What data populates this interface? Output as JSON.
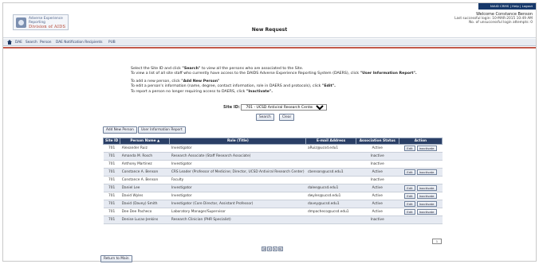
{
  "header": {
    "logo_line1": "Adverse Experience Reporting",
    "logo_line2": "Division of AIDS",
    "page_title": "New Request",
    "toplinks": "NIAID CRMS | Help | Logout",
    "welcome_name": "Welcome Constance Benson",
    "welcome_line1": "Last successful login: 10-MAR-2015 10:49 AM",
    "welcome_line2": "No. of unsuccessful login attempts: 0"
  },
  "nav": {
    "items": [
      "DAE",
      "Search",
      "Person",
      "DAE Notification Recipients",
      "PUB"
    ]
  },
  "instructions": {
    "line1a": "Select the Site ID and click ",
    "line1b": "\"Search\"",
    "line1c": " to view all the persons who are associated to the Site.",
    "line2a": "To view a list of all site staff who currently have access to the DAIDS Adverse Experience Reporting System (DAERS), click ",
    "line2b": "\"User Information Report\".",
    "line3a": "To add a new person, click ",
    "line3b": "\"Add New Person\"",
    "line4a": "To edit a person's information (name, degree, contact information, role in DAERS and protocols), click ",
    "line4b": "\"Edit\".",
    "line5a": "To report a person no longer requiring access to DAERS, click ",
    "line5b": "\"Inactivate\"."
  },
  "site": {
    "label": "Site ID:",
    "selected": "701 - UCSD Antiviral Research Center CRS"
  },
  "buttons": {
    "search": "Search",
    "clear": "Clear",
    "add_person": "Add New Person",
    "user_report": "User Information Report",
    "return": "Return to Main",
    "edit": "Edit",
    "inactivate": "Inactivate"
  },
  "table": {
    "headers": [
      "Site ID",
      "Person Name ▲",
      "Role (Title)",
      "E-mail Address",
      "Association Status",
      "Action"
    ],
    "rows": [
      {
        "site": "701",
        "name": "Alexander Ruiz",
        "role": "Investigator",
        "email": "aRuiz@ucsd.edu1",
        "status": "Active",
        "actions": true
      },
      {
        "site": "701",
        "name": "Amanda M. Rosch",
        "role": "Research Associate (Staff Research Associate)",
        "email": "",
        "status": "Inactive",
        "actions": false
      },
      {
        "site": "701",
        "name": "Anthony Martinez",
        "role": "Investigator",
        "email": "",
        "status": "Inactive",
        "actions": false
      },
      {
        "site": "701",
        "name": "Constance A. Benson",
        "role": "CRS Leader (Professor of Medicine; Director, UCSD Antiviral Research Center)",
        "email": "cbenson@ucsd.edu1",
        "status": "Active",
        "actions": true
      },
      {
        "site": "701",
        "name": "Constance A. Benson",
        "role": "Faculty",
        "email": "",
        "status": "Inactive",
        "actions": false
      },
      {
        "site": "701",
        "name": "Daniel Lee",
        "role": "Investigator",
        "email": "dalee@ucsd.edu1",
        "status": "Active",
        "actions": true
      },
      {
        "site": "701",
        "name": "David Wyles",
        "role": "Investigator",
        "email": "dwyles@ucsd.edu1",
        "status": "Active",
        "actions": true
      },
      {
        "site": "701",
        "name": "David (Davey) Smith",
        "role": "Investigator (Core Director, Assistant Professor)",
        "email": "davey@ucsd.edu1",
        "status": "Active",
        "actions": true
      },
      {
        "site": "701",
        "name": "Dee Dee Pacheco",
        "role": "Laboratory Manager/Supervisor",
        "email": "dmpacheco@ucsd.edu1",
        "status": "Active",
        "actions": true
      },
      {
        "site": "701",
        "name": "Denise Lucas-Jenkins",
        "role": "Research Clinician (PHR Specialist)",
        "email": "",
        "status": "Inactive",
        "actions": false
      }
    ]
  },
  "pagination": {
    "page_select": "1",
    "controls": [
      "|◂",
      "◂",
      "▸",
      "▸|"
    ]
  },
  "colors": {
    "header_bar": "#2a3f66",
    "accent_red": "#b3311f",
    "alt_row": "#e6eaf2"
  }
}
